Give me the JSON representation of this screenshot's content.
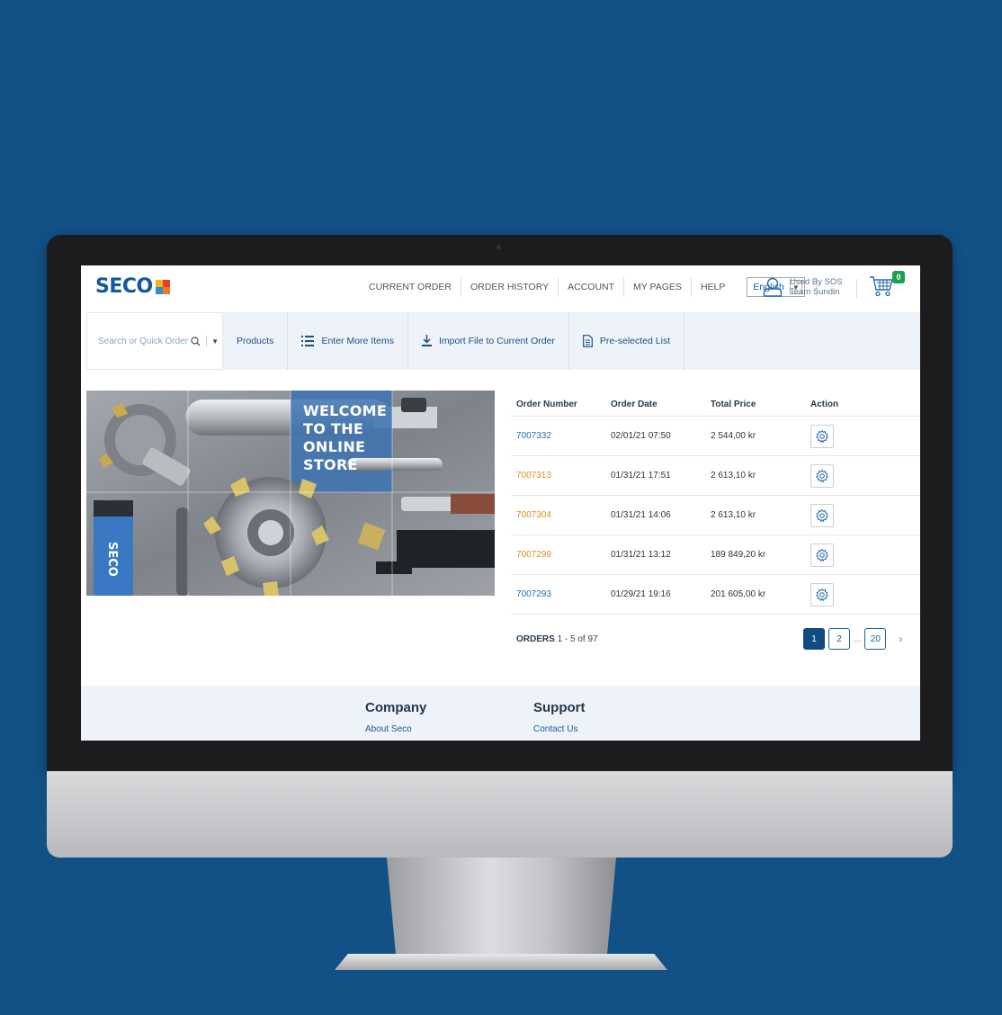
{
  "header": {
    "logo_text": "SECO",
    "nav": [
      "CURRENT ORDER",
      "ORDER HISTORY",
      "ACCOUNT",
      "MY PAGES",
      "HELP"
    ],
    "language": "English",
    "user_line1": "Used By SOS",
    "user_line2": "Team Sundin",
    "cart_count": "0"
  },
  "toolbar": {
    "search_placeholder": "Search or Quick Order",
    "products": "Products",
    "enter_more_items": "Enter More Items",
    "import_file": "Import File to Current Order",
    "preselected": "Pre-selected List"
  },
  "hero": {
    "line1": "WELCOME",
    "line2": "TO THE",
    "line3": "ONLINE",
    "line4": "STORE"
  },
  "orders": {
    "columns": [
      "Order Number",
      "Order Date",
      "Total Price",
      "Action"
    ],
    "rows": [
      {
        "number": "7007332",
        "date": "02/01/21 07:50",
        "price": "2 544,00 kr",
        "color": "#1f6fb5"
      },
      {
        "number": "7007313",
        "date": "01/31/21 17:51",
        "price": "2 613,10 kr",
        "color": "#d9901f"
      },
      {
        "number": "7007304",
        "date": "01/31/21 14:06",
        "price": "2 613,10 kr",
        "color": "#d9901f"
      },
      {
        "number": "7007299",
        "date": "01/31/21 13:12",
        "price": "189 849,20 kr",
        "color": "#d9901f"
      },
      {
        "number": "7007293",
        "date": "01/29/21 19:16",
        "price": "201 605,00 kr",
        "color": "#1f6fb5"
      }
    ],
    "summary_label": "ORDERS",
    "summary_range": "1 - 5 of 97",
    "pages": [
      "1",
      "2",
      "20"
    ],
    "ellipsis": "...",
    "next": "›"
  },
  "footer": {
    "company_title": "Company",
    "company_link": "About Seco",
    "support_title": "Support",
    "support_link": "Contact Us"
  },
  "colors": {
    "background": "#125186",
    "brand_blue": "#1158a0",
    "link_orange": "#d9901f",
    "cart_badge": "#19a152"
  }
}
